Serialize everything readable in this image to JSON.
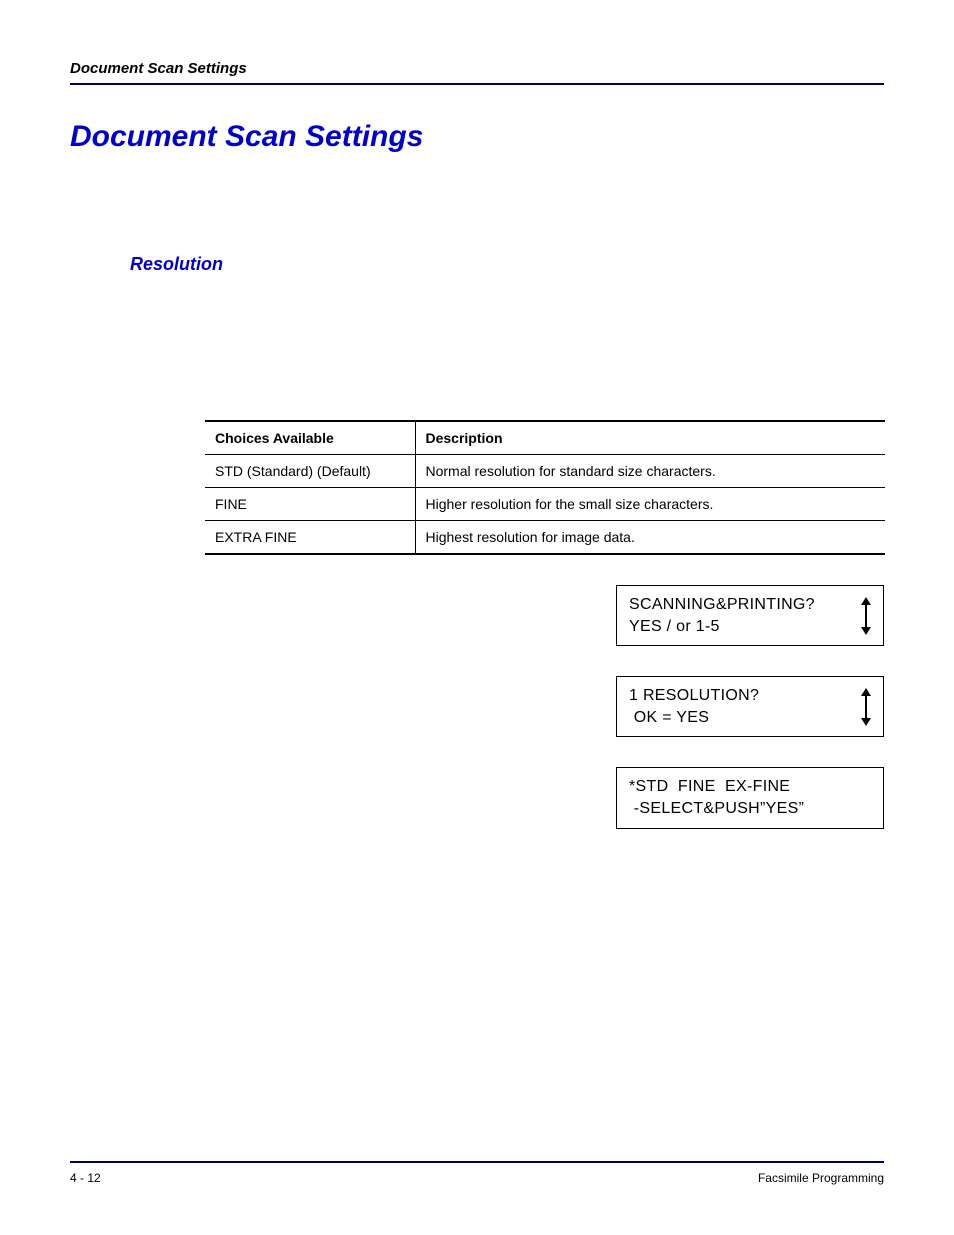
{
  "header": {
    "running": "Document Scan Settings"
  },
  "title": "Document Scan Settings",
  "subheading": "Resolution",
  "table": {
    "headers": [
      "Choices Available",
      "Description"
    ],
    "rows": [
      {
        "choice": "STD (Standard) (Default)",
        "desc": "Normal resolution for standard size characters."
      },
      {
        "choice": "FINE",
        "desc": "Higher resolution for the small size characters."
      },
      {
        "choice": "EXTRA FINE",
        "desc": "Highest resolution for image data."
      }
    ]
  },
  "lcd": [
    {
      "line1": "SCANNING&PRINTING?",
      "line2": "YES / or 1-5",
      "arrows": true
    },
    {
      "line1": "1 RESOLUTION?",
      "line2": " OK = YES",
      "arrows": true
    },
    {
      "line1": "*STD  FINE  EX-FINE",
      "line2": " -SELECT&PUSH”YES”",
      "arrows": false
    }
  ],
  "footer": {
    "left": "4 - 12",
    "right": "Facsimile Programming"
  }
}
